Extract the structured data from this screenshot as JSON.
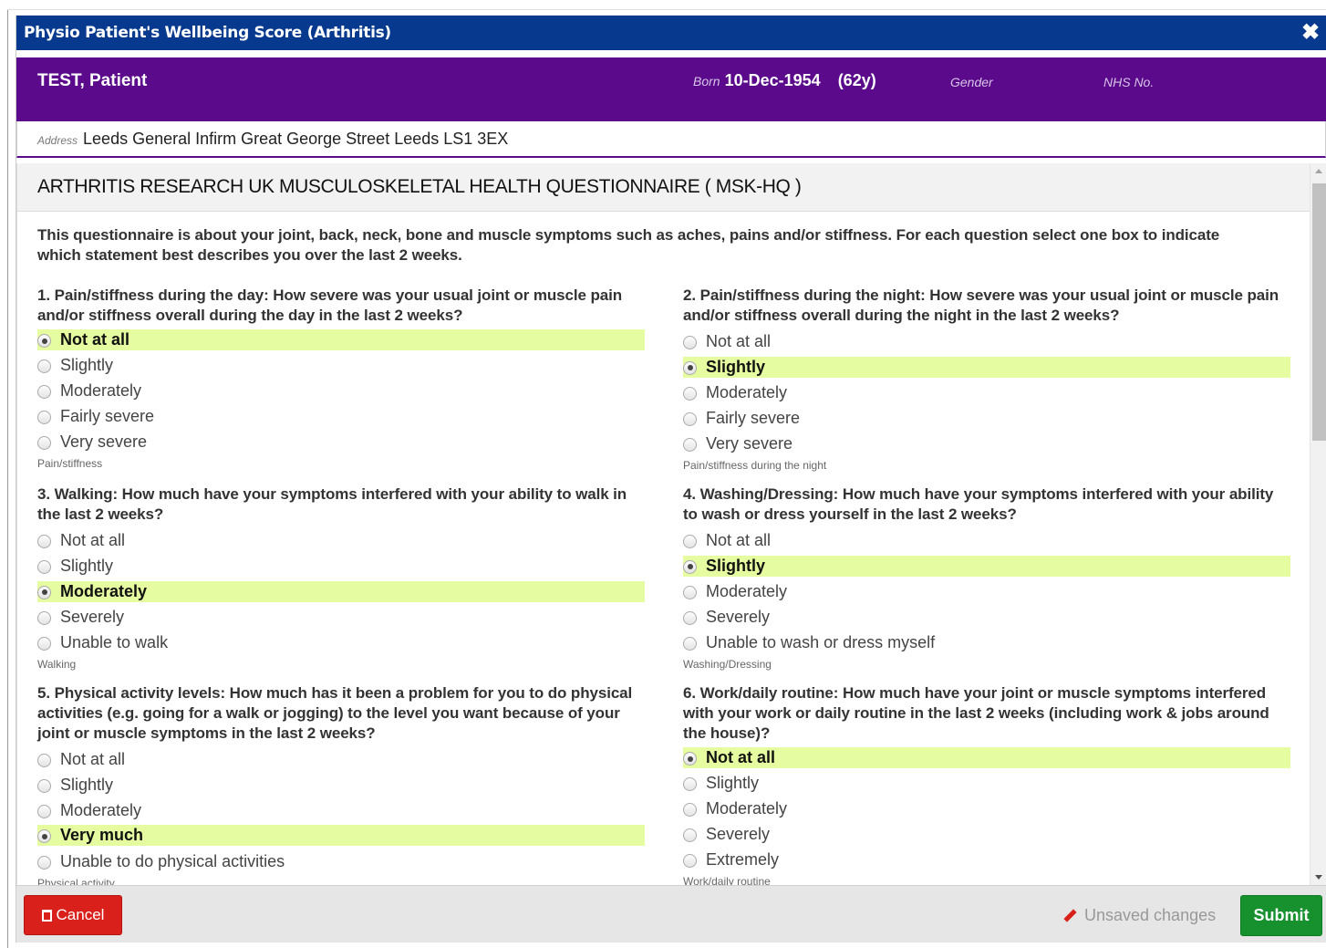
{
  "window": {
    "title": "Physio Patient's Wellbeing Score (Arthritis)",
    "close_symbol": "✖"
  },
  "patient": {
    "name": "TEST, Patient",
    "born_label": "Born",
    "born_date": "10-Dec-1954",
    "age": "(62y)",
    "gender_label": "Gender",
    "nhs_label": "NHS No.",
    "address_label": "Address",
    "address": "Leeds General Infirm Great George Street Leeds LS1 3EX"
  },
  "form": {
    "heading": "ARTHRITIS RESEARCH UK MUSCULOSKELETAL HEALTH QUESTIONNAIRE ( MSK-HQ )",
    "intro": "This questionnaire is about your joint, back, neck, bone and muscle symptoms such as aches, pains and/or stiffness. For each question select one box to indicate which statement best describes you over the last 2 weeks.",
    "questions": [
      {
        "text": "1. Pain/stiffness during the day: How severe was your usual joint or muscle pain and/or stiffness overall during the day in the last 2 weeks?",
        "options": [
          "Not at all",
          "Slightly",
          "Moderately",
          "Fairly severe",
          "Very severe"
        ],
        "selected": "Not at all",
        "footer": "Pain/stiffness"
      },
      {
        "text": "2. Pain/stiffness during the night: How severe was your usual joint or muscle pain and/or stiffness overall during the night in the last 2 weeks?",
        "options": [
          "Not at all",
          "Slightly",
          "Moderately",
          "Fairly severe",
          "Very severe"
        ],
        "selected": "Slightly",
        "footer": "Pain/stiffness during the night"
      },
      {
        "text": "3. Walking: How much have your symptoms interfered with your ability to walk in the last 2 weeks?",
        "options": [
          "Not at all",
          "Slightly",
          "Moderately",
          "Severely",
          "Unable to walk"
        ],
        "selected": "Moderately",
        "footer": "Walking"
      },
      {
        "text": "4. Washing/Dressing: How much have your symptoms interfered with your ability to wash or dress yourself in the last 2 weeks?",
        "options": [
          "Not at all",
          "Slightly",
          "Moderately",
          "Severely",
          "Unable to wash or dress myself"
        ],
        "selected": "Slightly",
        "footer": "Washing/Dressing"
      },
      {
        "text": "5. Physical activity levels: How much has it been a problem for you to do physical activities (e.g. going for a walk or jogging) to the level you want because of your joint or muscle symptoms in the last 2 weeks?",
        "options": [
          "Not at all",
          "Slightly",
          "Moderately",
          "Very much",
          "Unable to do physical activities"
        ],
        "selected": "Very much",
        "footer": "Physical activity"
      },
      {
        "text": "6. Work/daily routine: How much have your joint or muscle symptoms interfered with your work or daily routine in the last 2 weeks (including work & jobs around the house)?",
        "options": [
          "Not at all",
          "Slightly",
          "Moderately",
          "Severely",
          "Extremely"
        ],
        "selected": "Not at all",
        "footer": "Work/daily routine"
      }
    ]
  },
  "footer": {
    "cancel_label": "Cancel",
    "unsaved_label": "Unsaved changes",
    "submit_label": "Submit"
  },
  "colors": {
    "titlebar": "#073a8f",
    "banner": "#5b0a8c",
    "selected_highlight": "#e5fca0",
    "cancel": "#d9201b",
    "submit": "#16912e"
  }
}
